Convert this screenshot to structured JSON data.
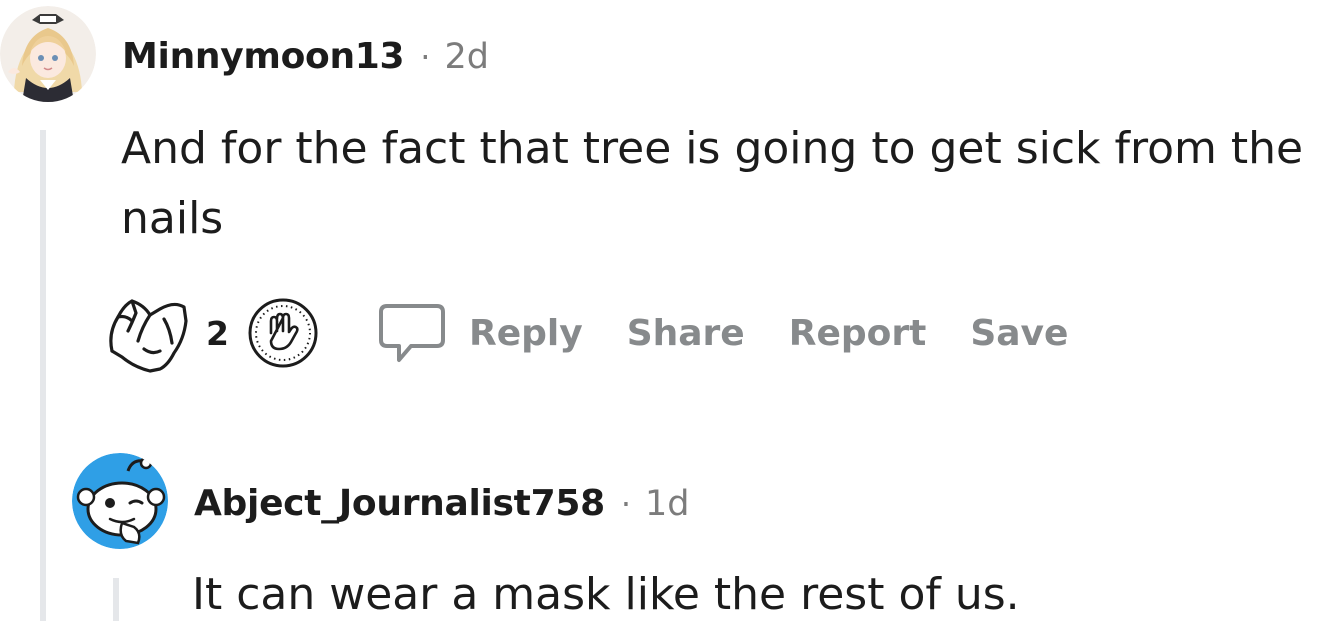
{
  "comments": [
    {
      "author": "Minnymoon13",
      "separator": "·",
      "time": "2d",
      "body_line1": "And for the fact that tree is going to get sick from the",
      "body_line2": "nails",
      "vote_count": "2",
      "actions": {
        "reply": "Reply",
        "share": "Share",
        "report": "Report",
        "save": "Save"
      }
    },
    {
      "author": "Abject_Journalist758",
      "separator": "·",
      "time": "1d",
      "body": "It can wear a mask like the rest of us."
    }
  ],
  "colors": {
    "thread_line": "#e5e7ea",
    "meta_text": "#7c7c7c",
    "action_text": "#878a8c",
    "snoo_blue": "#2f9fe6"
  }
}
